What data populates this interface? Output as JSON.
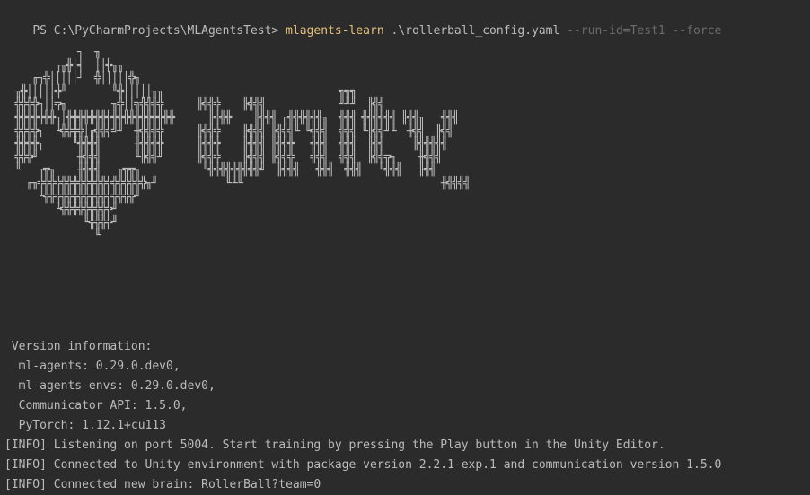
{
  "prompt": {
    "prefix": "PS C:\\PyCharmProjects\\MLAgentsTest> ",
    "command": "mlagents-learn",
    "argument": " .\\rollerball_config.yaml ",
    "options": "--run-id=Test1 --force"
  },
  "banner_art": "            ┐  ╖\n        ╓╖╬│╡  ││╬╖╖\n    ╓╖╬│││││┘  ╬│││││╬╖\n ╖╬│││││╬╜        ╙╬│││││╖╖                               ╗╗╗\n ╬╬╬╬╖││╦╖        ╖╬││╗╣╣╣╬      ╟╣╣╬    ╟╣╣╣             ╜╜╜  ╟╣╣\n ╬╬╬╬╬╬╬╖│╬╬╬╬╬╬╬╬╬╬╬╬╬╬╬╬╬╬╬      ╟╣╣╬    ╟╣╣╣ ╓╣╣╣╣╣╣╖  ╣╣╣ ╣╣╣╣╣╣ ╟╣╣╖   ╣╣╣\n ╬╬╬╬┐  ╙╬╬╬╬│╓╣╣╣╝╜  ╫╣╣╣╬      ╟╣╣╬    ╟╣╣╣ ╟╣╣╣╙ ╙╣╣╣  ╣╣╣ ╙╟╣╣╜╙  ╫╣╣  ╟╣╣\n ╬╬╬╬┐     ╙╬╬╣╣      ╫╣╣╣╬      ╟╣╣╬    ╟╣╣╣ ╟╣╣╬   ╣╣╣  ╣╣╣  ╟╣╣     ╟╣╣╣╣╣\n ╬╬╬╜       ╫╣╣╣      ╙╟╣╣╜      ╟╣╣╬    ╟╣╣╣ ╟╣╣╬   ╣╣╣  ╣╣╣  ╟╣╣╦╖    ╫╣╣╣\n ╙   ╓╦╖    ╫╣╣╣   ╓╦╦╖           ╙╣╣╣╣╣╣╣╣╣╝  ╟╣╣╣   ╣╣╣  ╣╣╣   ╙╣╣╣   ╟╣╣\n   ╓╖╬╬╬╬╬╬╬╬╬╬╬╬╬╬╬╬╬╬╬╖╜            ╙╙╙                                   ╫╣╣╣╣\n     ╙╬╬╬╬╬╬╬╬╬╬╬╬╬╬╬╬╜\n        ╙╬╬╬╬╬╬╬╬╬╜\n             ╙╬╬╬╬╜\n               ╙",
  "version": {
    "heading": " Version information:",
    "lines": [
      "  ml-agents: 0.29.0.dev0,",
      "  ml-agents-envs: 0.29.0.dev0,",
      "  Communicator API: 1.5.0,",
      "  PyTorch: 1.12.1+cu113"
    ]
  },
  "logs": [
    "[INFO] Listening on port 5004. Start training by pressing the Play button in the Unity Editor.",
    "[INFO] Connected to Unity environment with package version 2.2.1-exp.1 and communication version 1.5.0",
    "[INFO] Connected new brain: RollerBall?team=0"
  ],
  "colors": {
    "background": "#2b2b2b",
    "text": "#bbbbbb",
    "command": "#e5c07b",
    "options": "#6b6b6b"
  }
}
